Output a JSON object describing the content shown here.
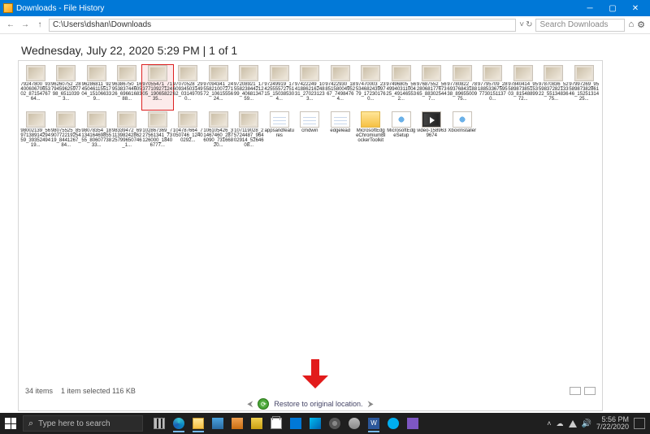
{
  "titlebar": {
    "title": "Downloads - File History"
  },
  "address": {
    "path": "C:\\Users\\dshan\\Downloads",
    "search_placeholder": "Search Downloads"
  },
  "heading": "Wednesday, July 22, 2020 5:29 PM   |   1 of 1",
  "items": [
    {
      "label": "79247800_934006067065302_8715476764...",
      "type": "img",
      "selected": false
    },
    {
      "label": "96260752_287945962597798_65110393...",
      "type": "img",
      "selected": false
    },
    {
      "label": "96286811_924504611551704_151066339...",
      "type": "img",
      "selected": false
    },
    {
      "label": "96386750_169538374460526_6966168388...",
      "type": "img",
      "selected": false
    },
    {
      "label": "97055471_713771092712405_1906582235...",
      "type": "img",
      "selected": true
    },
    {
      "label": "97070528_296093450314962_031497050...",
      "type": "img",
      "selected": false
    },
    {
      "label": "97094341_245582100727172_1061555624...",
      "type": "img",
      "selected": false
    },
    {
      "label": "97208921_175582384421299_4068134759...",
      "type": "img",
      "selected": false
    },
    {
      "label": "97249919_174255557275115_150385304...",
      "type": "img",
      "selected": false
    },
    {
      "label": "97422249_104188621624831_270231233...",
      "type": "img",
      "selected": false
    },
    {
      "label": "97422930_188515800495267_74984764...",
      "type": "img",
      "selected": false
    },
    {
      "label": "97470003_235346824399779_172301760...",
      "type": "img",
      "selected": false
    },
    {
      "label": "97496805_564994031100425_491465532...",
      "type": "img",
      "selected": false
    },
    {
      "label": "97687552_562806817767365_883025447...",
      "type": "img",
      "selected": false
    },
    {
      "label": "97780822_786937684318838_8965500975...",
      "type": "img",
      "selected": false
    },
    {
      "label": "97795709_281885336759577301511370...",
      "type": "img",
      "selected": false
    },
    {
      "label": "97840414_955898738515303_8154889972...",
      "type": "img",
      "selected": false
    },
    {
      "label": "97870836_525983728213322_5513483675...",
      "type": "img",
      "selected": false
    },
    {
      "label": "97997269_955898738286146_1525131425...",
      "type": "img",
      "selected": false
    },
    {
      "label": "98002139_569713891429459_3935249419...",
      "type": "img",
      "selected": false
    },
    {
      "label": "98075525_859077221925419_8441267_84...",
      "type": "img",
      "selected": false
    },
    {
      "label": "98078354_181341646985555_8060773833...",
      "type": "img",
      "selected": false
    },
    {
      "label": "98339472_691139824286225799650746_1...",
      "type": "img",
      "selected": false
    },
    {
      "label": "102867369_727561341_73126000_18406777...",
      "type": "img",
      "selected": false
    },
    {
      "label": "104787664_7050746_12400292...",
      "type": "img",
      "selected": false
    },
    {
      "label": "106105426_31467460_2876090_73166820...",
      "type": "img",
      "selected": false
    },
    {
      "label": "107119028_25724487_96402914_5264608...",
      "type": "img",
      "selected": false
    },
    {
      "label": "appsandfeatures",
      "type": "text",
      "selected": false
    },
    {
      "label": "cmdwin",
      "type": "text",
      "selected": false
    },
    {
      "label": "edgelead",
      "type": "text",
      "selected": false
    },
    {
      "label": "MicrosoftEdgeChromiumBlockerToolkit",
      "type": "folder",
      "selected": false
    },
    {
      "label": "MicrosoftEdgeSetup",
      "type": "app",
      "selected": false
    },
    {
      "label": "video-1589639674",
      "type": "video",
      "selected": false
    },
    {
      "label": "XboxInstaller",
      "type": "app",
      "selected": false
    }
  ],
  "status": {
    "count": "34 items",
    "selection": "1 item selected  116 KB"
  },
  "restore": {
    "tooltip": "Restore to original location."
  },
  "taskbar": {
    "search_placeholder": "Type here to search",
    "time": "5:56 PM",
    "date": "7/22/2020"
  }
}
